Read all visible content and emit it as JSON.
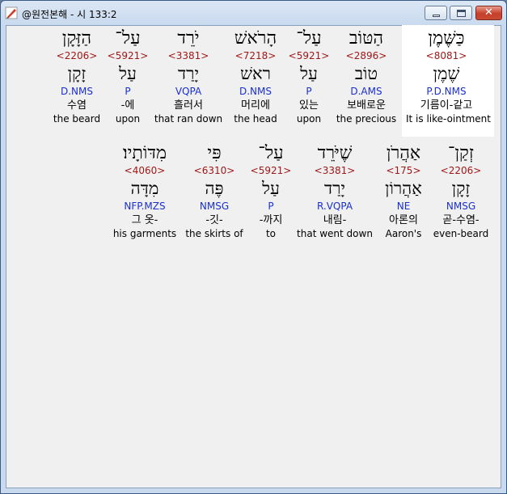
{
  "window": {
    "title": "@원전본해 - 시 133:2",
    "controls": {
      "minimize": "minimize",
      "maximize": "maximize",
      "close": "✕"
    }
  },
  "colors": {
    "strong": "#a01818",
    "morph": "#1a2fcf",
    "highlight_bg": "#ffffff",
    "client_bg": "#f0f0f0"
  },
  "rows": [
    {
      "words": [
        {
          "hebrew": "הַזָּקָן",
          "strong": "<2206>",
          "lemma": "זָקָן",
          "morph": "D.NMS",
          "korean": "수염",
          "english": "the beard"
        },
        {
          "hebrew": "עַל־",
          "strong": "<5921>",
          "lemma": "עַל",
          "morph": "P",
          "korean": "-에",
          "english": "upon"
        },
        {
          "hebrew": "יֹרֵד",
          "strong": "<3381>",
          "lemma": "יָרַד",
          "morph": "VQPA",
          "korean": "흘러서",
          "english": "that ran down"
        },
        {
          "hebrew": "הָרֹאשׁ",
          "strong": "<7218>",
          "lemma": "ראשׁ",
          "morph": "D.NMS",
          "korean": "머리에",
          "english": "the head"
        },
        {
          "hebrew": "עַל־",
          "strong": "<5921>",
          "lemma": "עַל",
          "morph": "P",
          "korean": "있는",
          "english": "upon"
        },
        {
          "hebrew": "הַטּוֹב",
          "strong": "<2896>",
          "lemma": "טוֹב",
          "morph": "D.AMS",
          "korean": "보배로운",
          "english": "the precious"
        },
        {
          "hebrew": "כַּשֶּׁמֶן",
          "strong": "<8081>",
          "lemma": "שֶׁמֶן",
          "morph": "P.D.NMS",
          "korean": "기름이-같고",
          "english": "It is like-ointment"
        }
      ]
    },
    {
      "words": [
        {
          "hebrew": "מִדּוֹתָיו׃",
          "strong": "<4060>",
          "lemma": "מִדָּה",
          "morph": "NFP.MZS",
          "korean": "그 옷-",
          "english": "his garments"
        },
        {
          "hebrew": "פִּי",
          "strong": "<6310>",
          "lemma": "פֶּה",
          "morph": "NMSG",
          "korean": "-깃-",
          "english": "the skirts of"
        },
        {
          "hebrew": "עַל־",
          "strong": "<5921>",
          "lemma": "עַל",
          "morph": "P",
          "korean": "-까지",
          "english": "to"
        },
        {
          "hebrew": "שֶׁיֹּרֵד",
          "strong": "<3381>",
          "lemma": "יָרַד",
          "morph": "R.VQPA",
          "korean": "내림-",
          "english": "that went down"
        },
        {
          "hebrew": "אַהֲרֹן",
          "strong": "<175>",
          "lemma": "אַהֲרוֹן",
          "morph": "NE",
          "korean": "아론의",
          "english": "Aaron's"
        },
        {
          "hebrew": "זְקַן־",
          "strong": "<2206>",
          "lemma": "זָקָן",
          "morph": "NMSG",
          "korean": "곧-수염-",
          "english": "even-beard"
        }
      ]
    }
  ]
}
